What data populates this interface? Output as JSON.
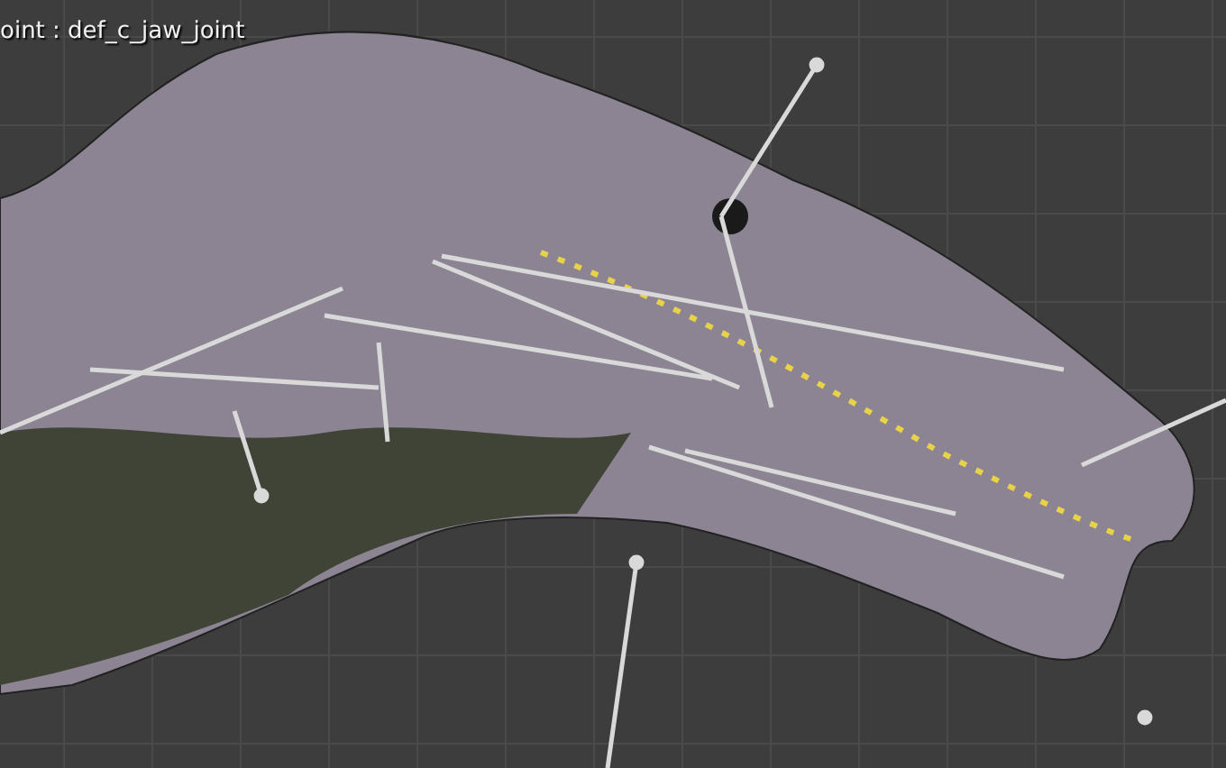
{
  "viewport": {
    "info_text": "oint : def_c_jaw_joint"
  }
}
